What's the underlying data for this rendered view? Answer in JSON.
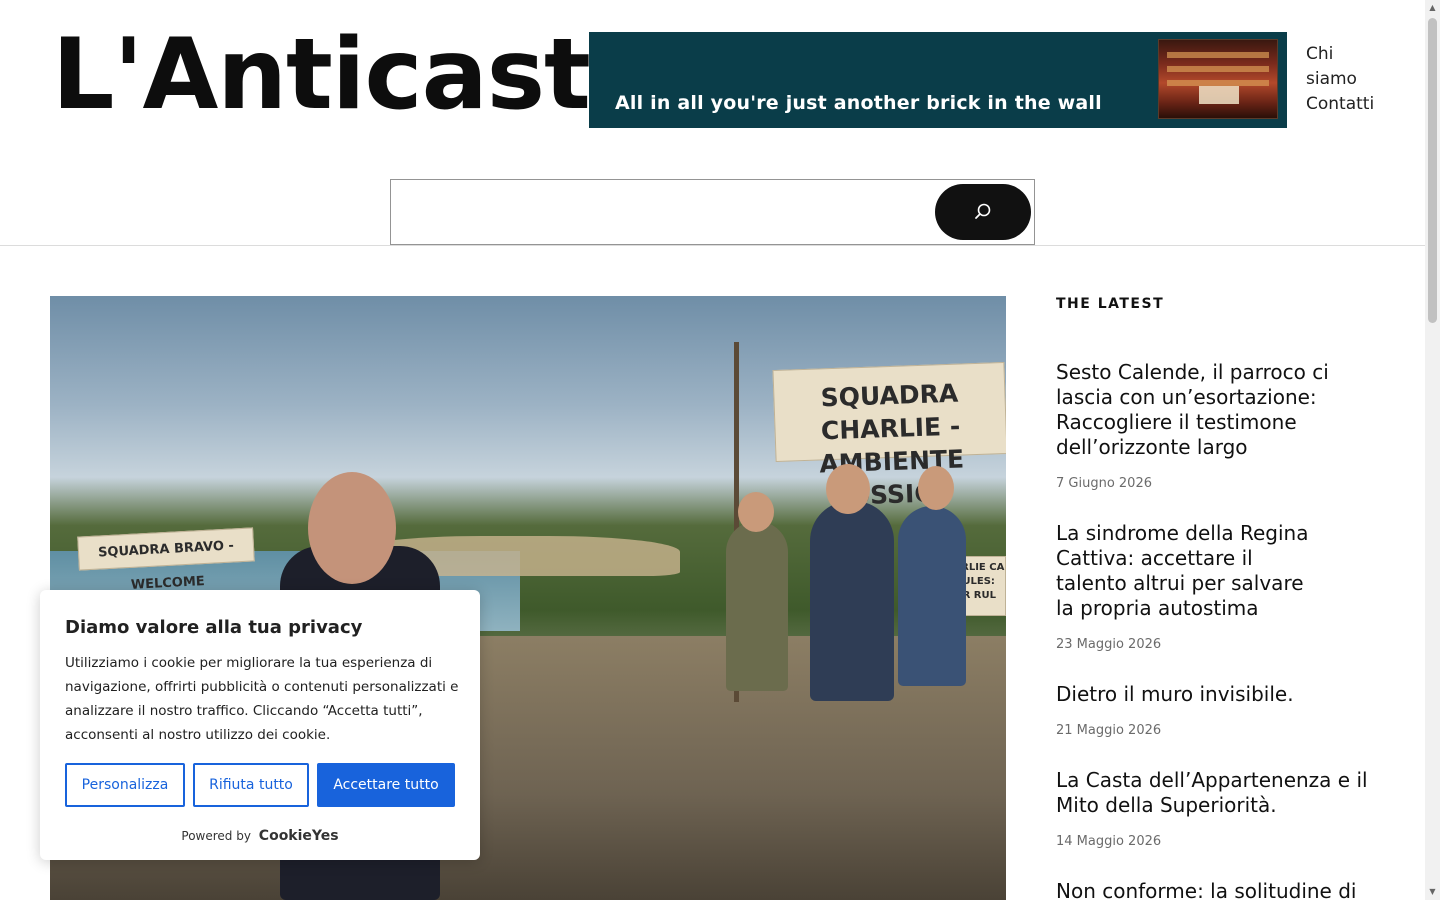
{
  "header": {
    "site_title": "L'Anticasta",
    "banner_text": "All in all you're just another brick in the wall",
    "nav": [
      "Chi siamo",
      "Contatti"
    ]
  },
  "search": {
    "placeholder": "",
    "value": "",
    "button_icon": "search-icon"
  },
  "hero": {
    "banner_charlie": "SQUADRA CHARLIE - AMBIENTE TOSSICO",
    "banner_bravo": "SQUADRA BRAVO - WELCOME",
    "sign_text": "CHARLIE CA - RULES: OUR RUL"
  },
  "sidebar": {
    "heading": "THE LATEST",
    "posts": [
      {
        "title": "Sesto Calende, il parroco ci lascia con un’esortazione: Raccogliere il testimone dell’orizzonte largo",
        "date": "7 Giugno 2026"
      },
      {
        "title": "La sindrome della Regina Cattiva: accettare il talento altrui per salvare la propria autostima",
        "date": "23 Maggio 2026"
      },
      {
        "title": "Dietro il muro invisibile.",
        "date": "21 Maggio 2026"
      },
      {
        "title": "La Casta dell’Appartenenza e il Mito della Superiorità.",
        "date": "14 Maggio 2026"
      },
      {
        "title": "Non conforme: la solitudine di",
        "date": ""
      }
    ]
  },
  "cookie": {
    "title": "Diamo valore alla tua privacy",
    "text": "Utilizziamo i cookie per migliorare la tua esperienza di navigazione, offrirti pubblicità o contenuti personalizzati e analizzare il nostro traffico. Cliccando “Accetta tutti”, acconsenti al nostro utilizzo dei cookie.",
    "customize": "Personalizza",
    "reject": "Rifiuta tutto",
    "accept": "Accettare tutto",
    "powered_by": "Powered by",
    "brand": "CookieYes"
  },
  "colors": {
    "banner_bg": "#0a3d49",
    "cookie_accent": "#1863dc",
    "search_button": "#111111"
  }
}
